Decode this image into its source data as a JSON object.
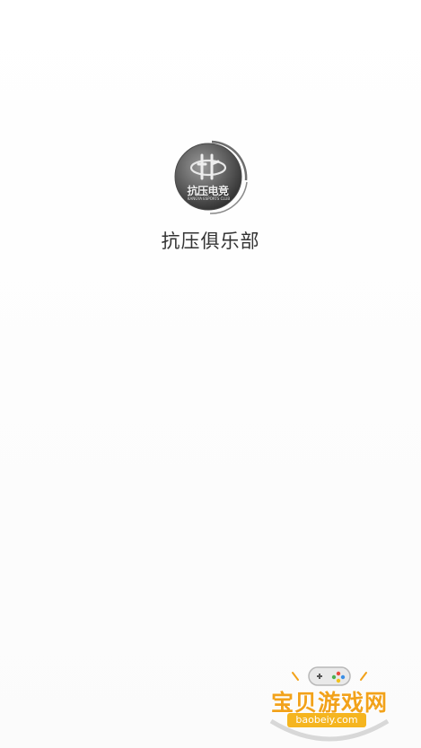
{
  "app": {
    "name": "抗压俱乐部",
    "logo": {
      "icon": "club-emblem-icon",
      "text": "抗压电竞",
      "subtext": "KANGYA ESPORTS CLUB"
    }
  },
  "watermark": {
    "title": "宝贝游戏网",
    "url": "baobeiy.com",
    "icon": "gamepad-icon"
  },
  "colors": {
    "background": "#ffffff",
    "app_name": "#333333",
    "watermark_orange": "#f2a21a",
    "watermark_badge": "#f5b51f"
  }
}
